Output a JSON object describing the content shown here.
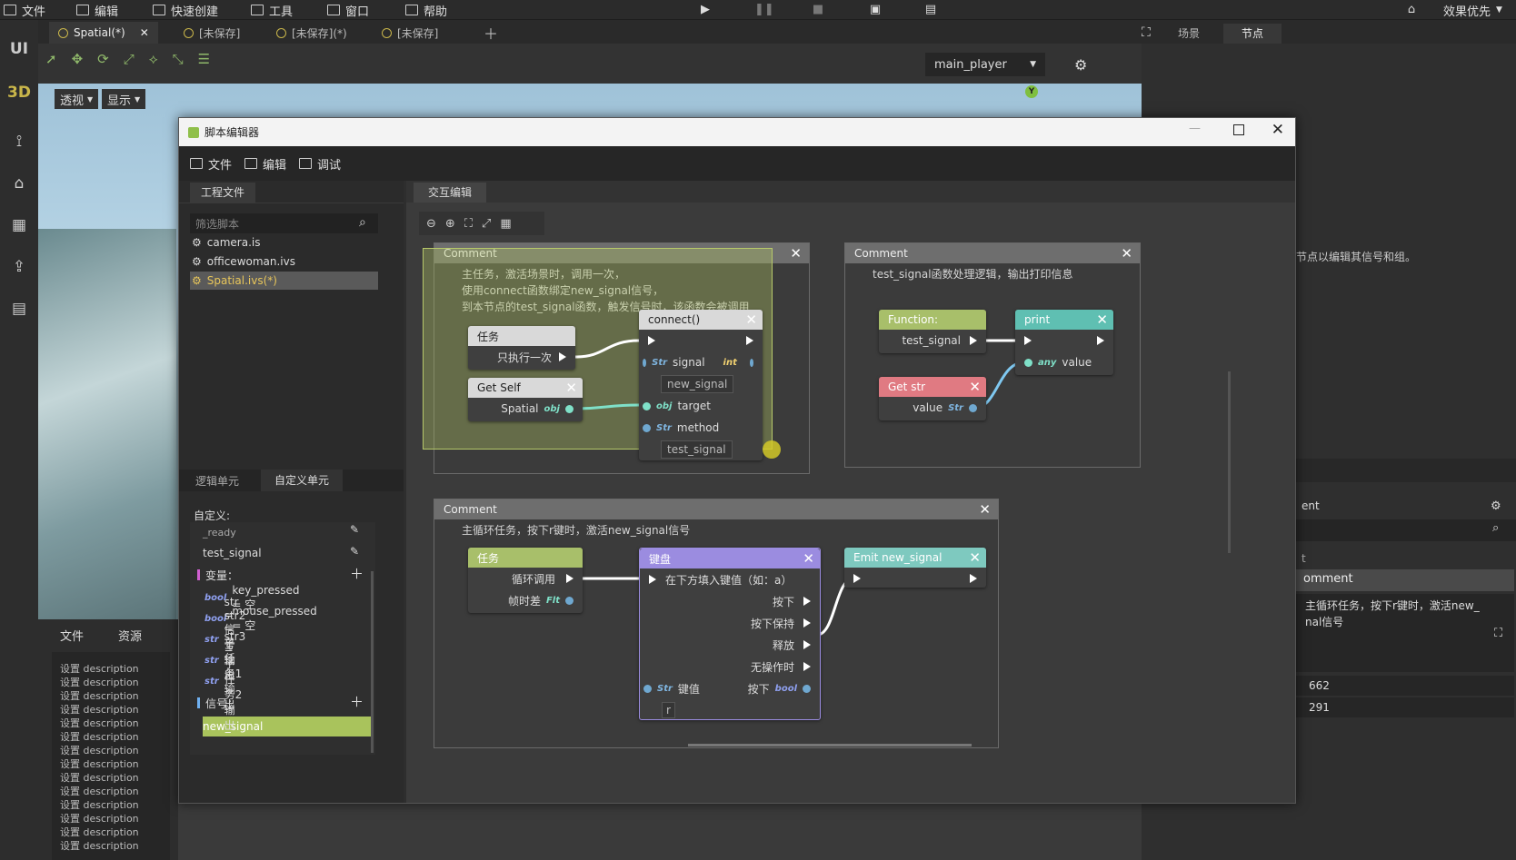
{
  "menu": {
    "file": "文件",
    "edit": "编辑",
    "quick_create": "快速创建",
    "tools": "工具",
    "window": "窗口",
    "help": "帮助",
    "quality": "效果优先"
  },
  "left_strip": {
    "ui": "UI",
    "three_d": "3D"
  },
  "tabs": [
    "Spatial(*)",
    "[未保存]",
    "[未保存](*)",
    "[未保存]"
  ],
  "viewport": {
    "perspective": "透视",
    "display": "显示",
    "player": "main_player"
  },
  "right_panel": {
    "tab_scene": "场景",
    "tab_node": "节点",
    "hint": "节点以编辑其信号和组。",
    "label_ent": "ent",
    "label_t": "t",
    "comment_label": "omment",
    "comment_text": "主循环任务，按下r键时，激活new_\nnal信号",
    "val1": "662",
    "val2": "291"
  },
  "editor": {
    "title": "脚本编辑器",
    "menu": {
      "file": "文件",
      "edit": "编辑",
      "debug": "调试"
    },
    "left": {
      "project_tab": "工程文件",
      "filter_placeholder": "筛选脚本",
      "files": [
        "camera.is",
        "officewoman.ivs",
        "Spatial.ivs(*)"
      ],
      "tab_logic": "逻辑单元",
      "tab_custom": "自定义单元",
      "custom_label": "自定义:",
      "functions": [
        "_ready",
        "test_signal"
      ],
      "var_label": "变量：",
      "variables": [
        {
          "type": "bool",
          "text": "key_pressed = 空"
        },
        {
          "type": "bool",
          "text": "mouse_pressed = 空"
        },
        {
          "type": "str",
          "text": "str = 信号输出"
        },
        {
          "type": "str",
          "text": "str2 = 子任务1输出"
        },
        {
          "type": "str",
          "text": "str3 = 子任务2输出"
        }
      ],
      "signal_label": "信号：",
      "signals": [
        "new_signal"
      ]
    },
    "canvas_tab": "交互编辑",
    "comment1": {
      "title": "Comment",
      "text": "主任务，激活场景时，调用一次，\n使用connect函数绑定new_signal信号，\n到本节点的test_signal函数，触发信号时，该函数会被调用"
    },
    "comment2": {
      "title": "Comment",
      "text": "test_signal函数处理逻辑，输出打印信息"
    },
    "comment3": {
      "title": "Comment",
      "text": "主循环任务，按下r键时，激活new_signal信号"
    },
    "node_task1": {
      "title": "任务",
      "out": "只执行一次"
    },
    "node_getself": {
      "title": "Get Self",
      "out": "Spatial",
      "type": "obj"
    },
    "node_connect": {
      "title": "connect()",
      "signal": "signal",
      "signal_val": "new_signal",
      "target": "target",
      "method": "method",
      "method_val": "test_signal",
      "int": "int",
      "str": "Str",
      "obj": "obj"
    },
    "node_function": {
      "title": "Function:",
      "out": "test_signal"
    },
    "node_getstr": {
      "title": "Get str",
      "out": "value",
      "type": "Str"
    },
    "node_print": {
      "title": "print",
      "in": "value",
      "type": "any"
    },
    "node_task2": {
      "title": "任务",
      "out1": "循环调用",
      "out2": "帧时差",
      "type": "Flt"
    },
    "node_key": {
      "title": "键盘",
      "hint": "在下方填入键值（如：a）",
      "o1": "按下",
      "o2": "按下保持",
      "o3": "释放",
      "o4": "无操作时",
      "key": "键值",
      "pressed": "按下",
      "type_in": "Str",
      "type_out": "bool",
      "value": "r"
    },
    "node_emit": {
      "title": "Emit new_signal"
    }
  },
  "bottom_panel": {
    "tab_file": "文件",
    "tab_res": "资源",
    "desc": "设置 description"
  },
  "colors": {
    "task_green": "#a8bf6a",
    "connect_gray": "#d9d9d9",
    "print_teal": "#5fbfb2",
    "getstr_red": "#e07a82",
    "key_purple": "#9b8ce0",
    "emit_teal": "#7ec9bf",
    "selection": "#a9c35c"
  }
}
